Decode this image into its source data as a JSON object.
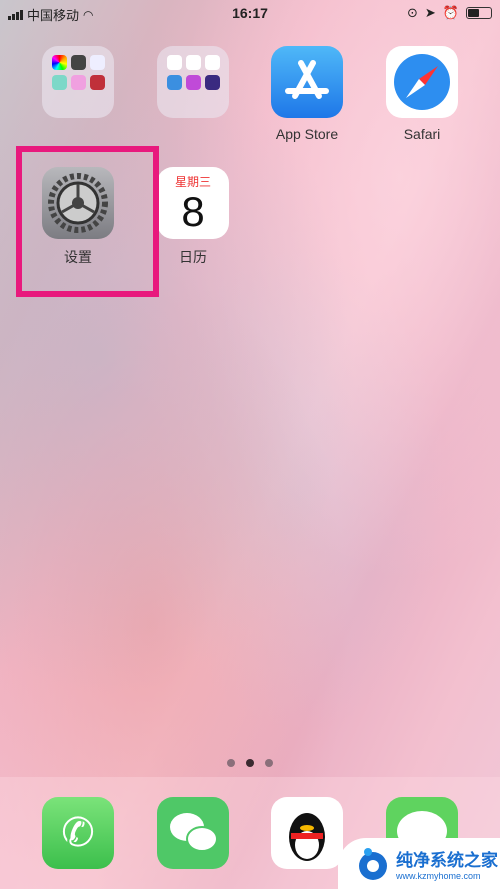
{
  "status": {
    "carrier": "中国移动",
    "time": "16:17",
    "battery_level": 0.5
  },
  "apps": [
    {
      "label": ""
    },
    {
      "label": ""
    },
    {
      "label": "App Store"
    },
    {
      "label": "Safari"
    },
    {
      "label": "设置"
    },
    {
      "label": "日历",
      "weekday": "星期三",
      "day": "8"
    }
  ],
  "page_indicator": {
    "pages": 3,
    "current": 2
  },
  "dock": [
    "Phone",
    "WeChat",
    "QQ",
    "Messages"
  ],
  "highlight_color": "#e8197d",
  "watermark": {
    "title": "纯净系统之家",
    "url": "www.kzmyhome.com"
  }
}
